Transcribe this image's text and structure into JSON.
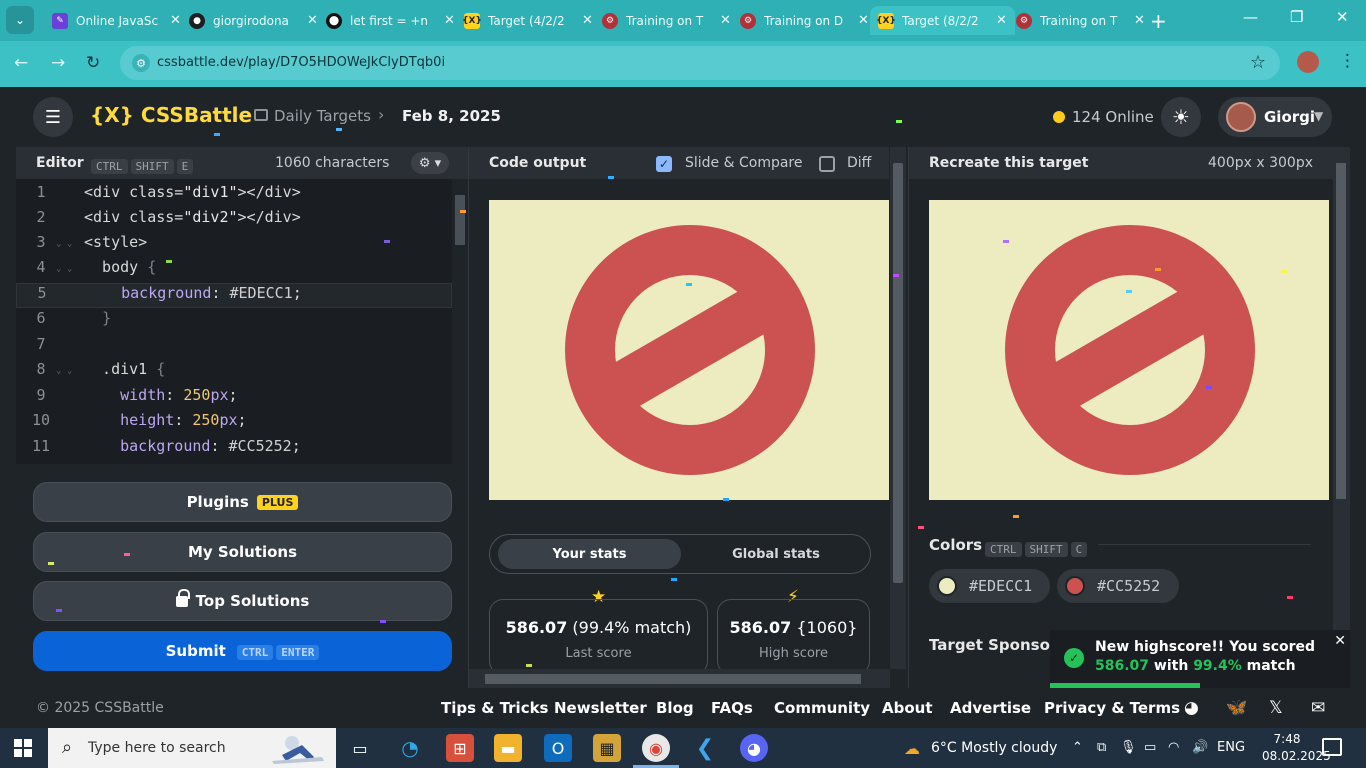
{
  "browser": {
    "tabs": [
      {
        "title": "Online JavaSc",
        "icon": "js-icon"
      },
      {
        "title": "giorgirodona",
        "icon": "github-icon"
      },
      {
        "title": "let first = +n",
        "icon": "dot-icon"
      },
      {
        "title": "Target (4/2/2",
        "icon": "cssbattle-icon"
      },
      {
        "title": "Training on T",
        "icon": "codewars-icon"
      },
      {
        "title": "Training on D",
        "icon": "codewars-icon"
      },
      {
        "title": "Target (8/2/2",
        "icon": "cssbattle-icon"
      },
      {
        "title": "Training on T",
        "icon": "codewars-icon"
      }
    ],
    "url": "cssbattle.dev/play/D7O5HDOWeJkClyDTqb0i"
  },
  "nav": {
    "logo": "{X} CSSBattle",
    "breadcrumb_1": "Daily Targets",
    "breadcrumb_2": "Feb 8, 2025",
    "online": "124 Online",
    "user_name": "Giorgi"
  },
  "editor": {
    "title": "Editor",
    "shortcut": [
      "CTRL",
      "SHIFT",
      "E"
    ],
    "char_count": "1060 characters",
    "lines": [
      "1",
      "2",
      "3",
      "4",
      "5",
      "6",
      "7",
      "8",
      "9",
      "10",
      "11"
    ]
  },
  "sidebar": {
    "plugins_label": "Plugins",
    "plugins_badge": "PLUS",
    "my_solutions_label": "My Solutions",
    "top_solutions_label": "Top Solutions",
    "submit_label": "Submit",
    "submit_shortcut": [
      "CTRL",
      "ENTER"
    ]
  },
  "output": {
    "title": "Code output",
    "slide_compare_label": "Slide & Compare",
    "slide_compare_checked": true,
    "diff_label": "Diff",
    "diff_checked": false
  },
  "stats": {
    "tab_yours": "Your stats",
    "tab_global": "Global stats",
    "last_score": "586.07",
    "last_match": "(99.4% match)",
    "last_label": "Last score",
    "high_score": "586.07",
    "high_chars": "{1060}",
    "high_label": "High score"
  },
  "target": {
    "title": "Recreate this target",
    "size": "400px x 300px",
    "colors_label": "Colors",
    "colors_shortcut": [
      "CTRL",
      "SHIFT",
      "C"
    ],
    "colors": [
      "#EDECC1",
      "#CC5252"
    ],
    "sponsor_label": "Target Sponsor"
  },
  "toast": {
    "line1": "New highscore!! You scored",
    "score": "586.07",
    "with": "with",
    "pct": "99.4%",
    "match": "match"
  },
  "footer": {
    "copyright": "© 2025 CSSBattle",
    "links": [
      "Tips & Tricks",
      "Newsletter",
      "Blog",
      "FAQs",
      "Community",
      "About",
      "Advertise",
      "Privacy & Terms"
    ]
  },
  "taskbar": {
    "search_placeholder": "Type here to search",
    "weather": "6°C  Mostly cloudy",
    "lang": "ENG",
    "time": "7:48",
    "date": "08.02.2025"
  },
  "theme": {
    "accent": "#ffd21f",
    "bg_color": "#EDECC1",
    "shape_color": "#CC5252",
    "submit_color": "#0a64d8",
    "success": "#25c25a"
  }
}
